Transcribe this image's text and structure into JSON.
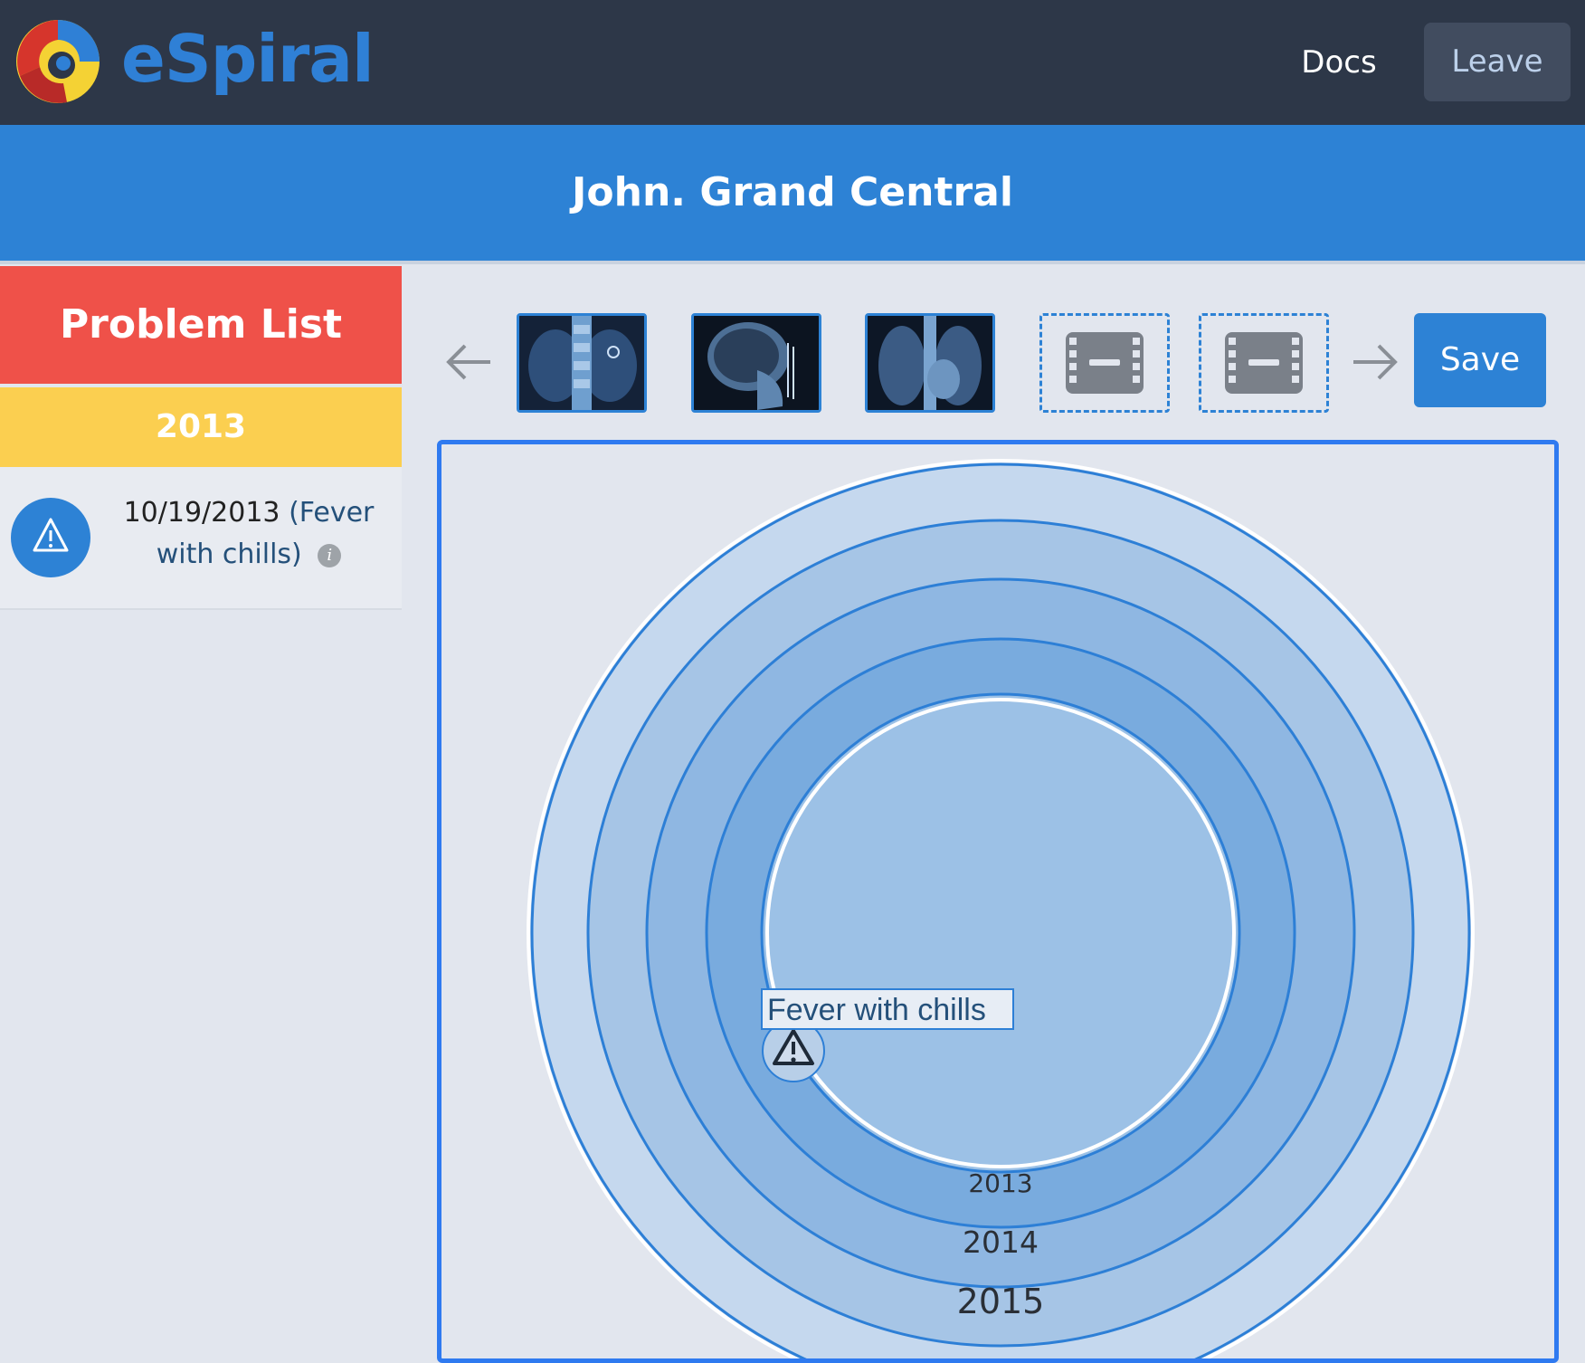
{
  "app": {
    "brand": "eSpiral"
  },
  "header": {
    "docs_label": "Docs",
    "leave_label": "Leave"
  },
  "patient": {
    "name": "John. Grand Central"
  },
  "sidebar": {
    "title": "Problem List",
    "year": "2013",
    "items": [
      {
        "date": "10/19/2013",
        "name": "(Fever with chills)",
        "icon": "warning-icon"
      }
    ]
  },
  "toolbar": {
    "save_label": "Save",
    "thumbnails": [
      {
        "kind": "xray",
        "subject": "abdomen"
      },
      {
        "kind": "xray",
        "subject": "skull"
      },
      {
        "kind": "xray",
        "subject": "chest"
      },
      {
        "kind": "empty",
        "icon": "film-icon"
      },
      {
        "kind": "empty",
        "icon": "film-icon"
      }
    ]
  },
  "spiral": {
    "event_label": "Fever with chills",
    "year_labels": [
      "2013",
      "2014",
      "2015"
    ]
  },
  "colors": {
    "topbar": "#2d3748",
    "brand": "#2f80d6",
    "patient_bar": "#2d82d5",
    "problem_head": "#ef5149",
    "year_head": "#fbcf50",
    "accent": "#2d82d5"
  }
}
